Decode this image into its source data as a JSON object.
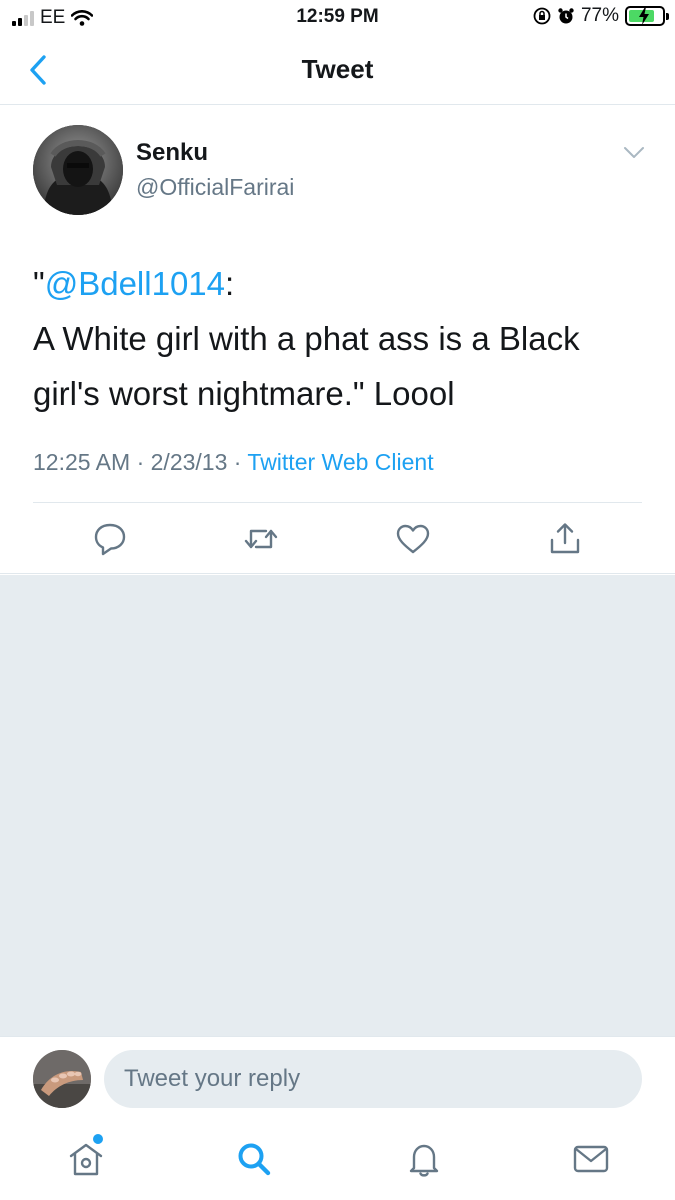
{
  "status_bar": {
    "carrier": "EE",
    "time": "12:59 PM",
    "battery_percent": "77%",
    "battery_level": 0.77
  },
  "nav": {
    "title": "Tweet"
  },
  "tweet": {
    "author_name": "Senku",
    "author_handle": "@OfficialFarirai",
    "text_open_quote": "\"",
    "mention": "@Bdell1014",
    "text_after_mention": ":",
    "text_body": "A White girl with a phat ass is a Black girl's worst nightmare.\" Loool",
    "time": "12:25 AM",
    "separator": " · ",
    "date": "2/23/13",
    "client": "Twitter Web Client"
  },
  "reply": {
    "placeholder": "Tweet your reply"
  },
  "colors": {
    "accent": "#1da1f2",
    "secondary_text": "#657786",
    "background_gray": "#e6ecf0",
    "battery_charging": "#4cd964"
  },
  "icons": {
    "back": "chevron-left-icon",
    "caret": "chevron-down-icon",
    "reply": "reply-icon",
    "retweet": "retweet-icon",
    "like": "heart-icon",
    "share": "share-icon",
    "home": "home-icon",
    "search": "search-icon",
    "notifications": "bell-icon",
    "messages": "mail-icon"
  }
}
